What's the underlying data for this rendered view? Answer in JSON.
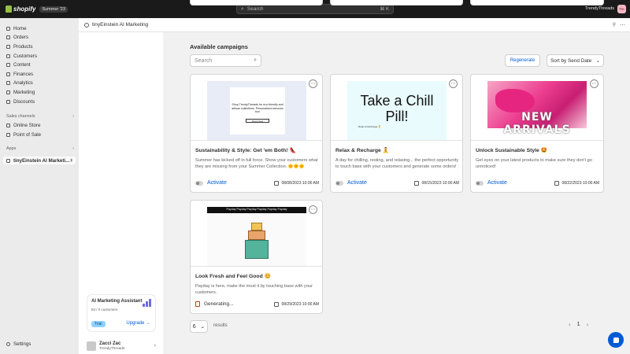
{
  "topbar": {
    "brand": "shopify",
    "edition": "Summer '23",
    "search_placeholder": "Search",
    "search_shortcut": "⌘ K",
    "store_name": "TrendyThreads",
    "store_initials": "Tre"
  },
  "sidebar": {
    "items": [
      {
        "label": "Home"
      },
      {
        "label": "Orders"
      },
      {
        "label": "Products"
      },
      {
        "label": "Customers"
      },
      {
        "label": "Content"
      },
      {
        "label": "Finances"
      },
      {
        "label": "Analytics"
      },
      {
        "label": "Marketing"
      },
      {
        "label": "Discounts"
      }
    ],
    "sales_channels_label": "Sales channels",
    "channels": [
      {
        "label": "Online Store"
      },
      {
        "label": "Point of Sale"
      }
    ],
    "apps_label": "Apps",
    "apps": [
      {
        "label": "tinyEinstein AI Marketi..."
      }
    ],
    "settings_label": "Settings"
  },
  "app": {
    "title": "tinyEinstein AI Marketing"
  },
  "assistant": {
    "title": "AI Marketing Assistant",
    "subtitle": "83 / 0 customers",
    "trial_label": "Trial",
    "upgrade_label": "Upgrade"
  },
  "profile": {
    "name": "Zacci Zac",
    "store": "TrendyThreads"
  },
  "campaigns": {
    "heading": "Available campaigns",
    "search_placeholder": "Search",
    "regenerate_label": "Regenerate",
    "sort_label": "Sort by Send Date",
    "activate_label": "Activate",
    "generating_label": "Generating...",
    "items": [
      {
        "title": "Sustainability & Style: Get 'em Both! 👠",
        "description": "Summer has kicked off in full force. Show your customers what they are missing from your Summer Collection. 🌞🌞🌞",
        "date": "08/08/2023 10:00 AM",
        "thumb_text": "Shop TrendyThreads for eco-friendly and artisan collections. Personalized services too!",
        "thumb_button": "Shop Now!"
      },
      {
        "title": "Relax & Recharge 🧘",
        "description": "A day for chilling, resting, and relaxing... the perfect opportunity to touch base with your customers and generate some orders!",
        "date": "08/15/2023 10:00 AM",
        "thumb_text": "Take a Chill Pill!",
        "thumb_small": "Relax & Recharge 🧘"
      },
      {
        "title": "Unlock Sustainable Style 🤩",
        "description": "Get eyes on your latest products to make sure they don't go unnoticed!",
        "date": "08/22/2023 10:00 AM",
        "thumb_text": "NEW ARRIVALS"
      },
      {
        "title": "Look Fresh and Feel Good 😊",
        "description": "Payday is here, make the most it by touching base with your customers.",
        "date": "08/29/2023 10:00 AM",
        "thumb_text": "Payday Payday Payday Payday Payday Payday"
      }
    ]
  },
  "pagination": {
    "per_page": "6",
    "results_label": "results",
    "page": "1"
  },
  "colors": {
    "accent": "#005bd3",
    "topbar": "#1a1a1a",
    "brand_green": "#95bf47"
  }
}
